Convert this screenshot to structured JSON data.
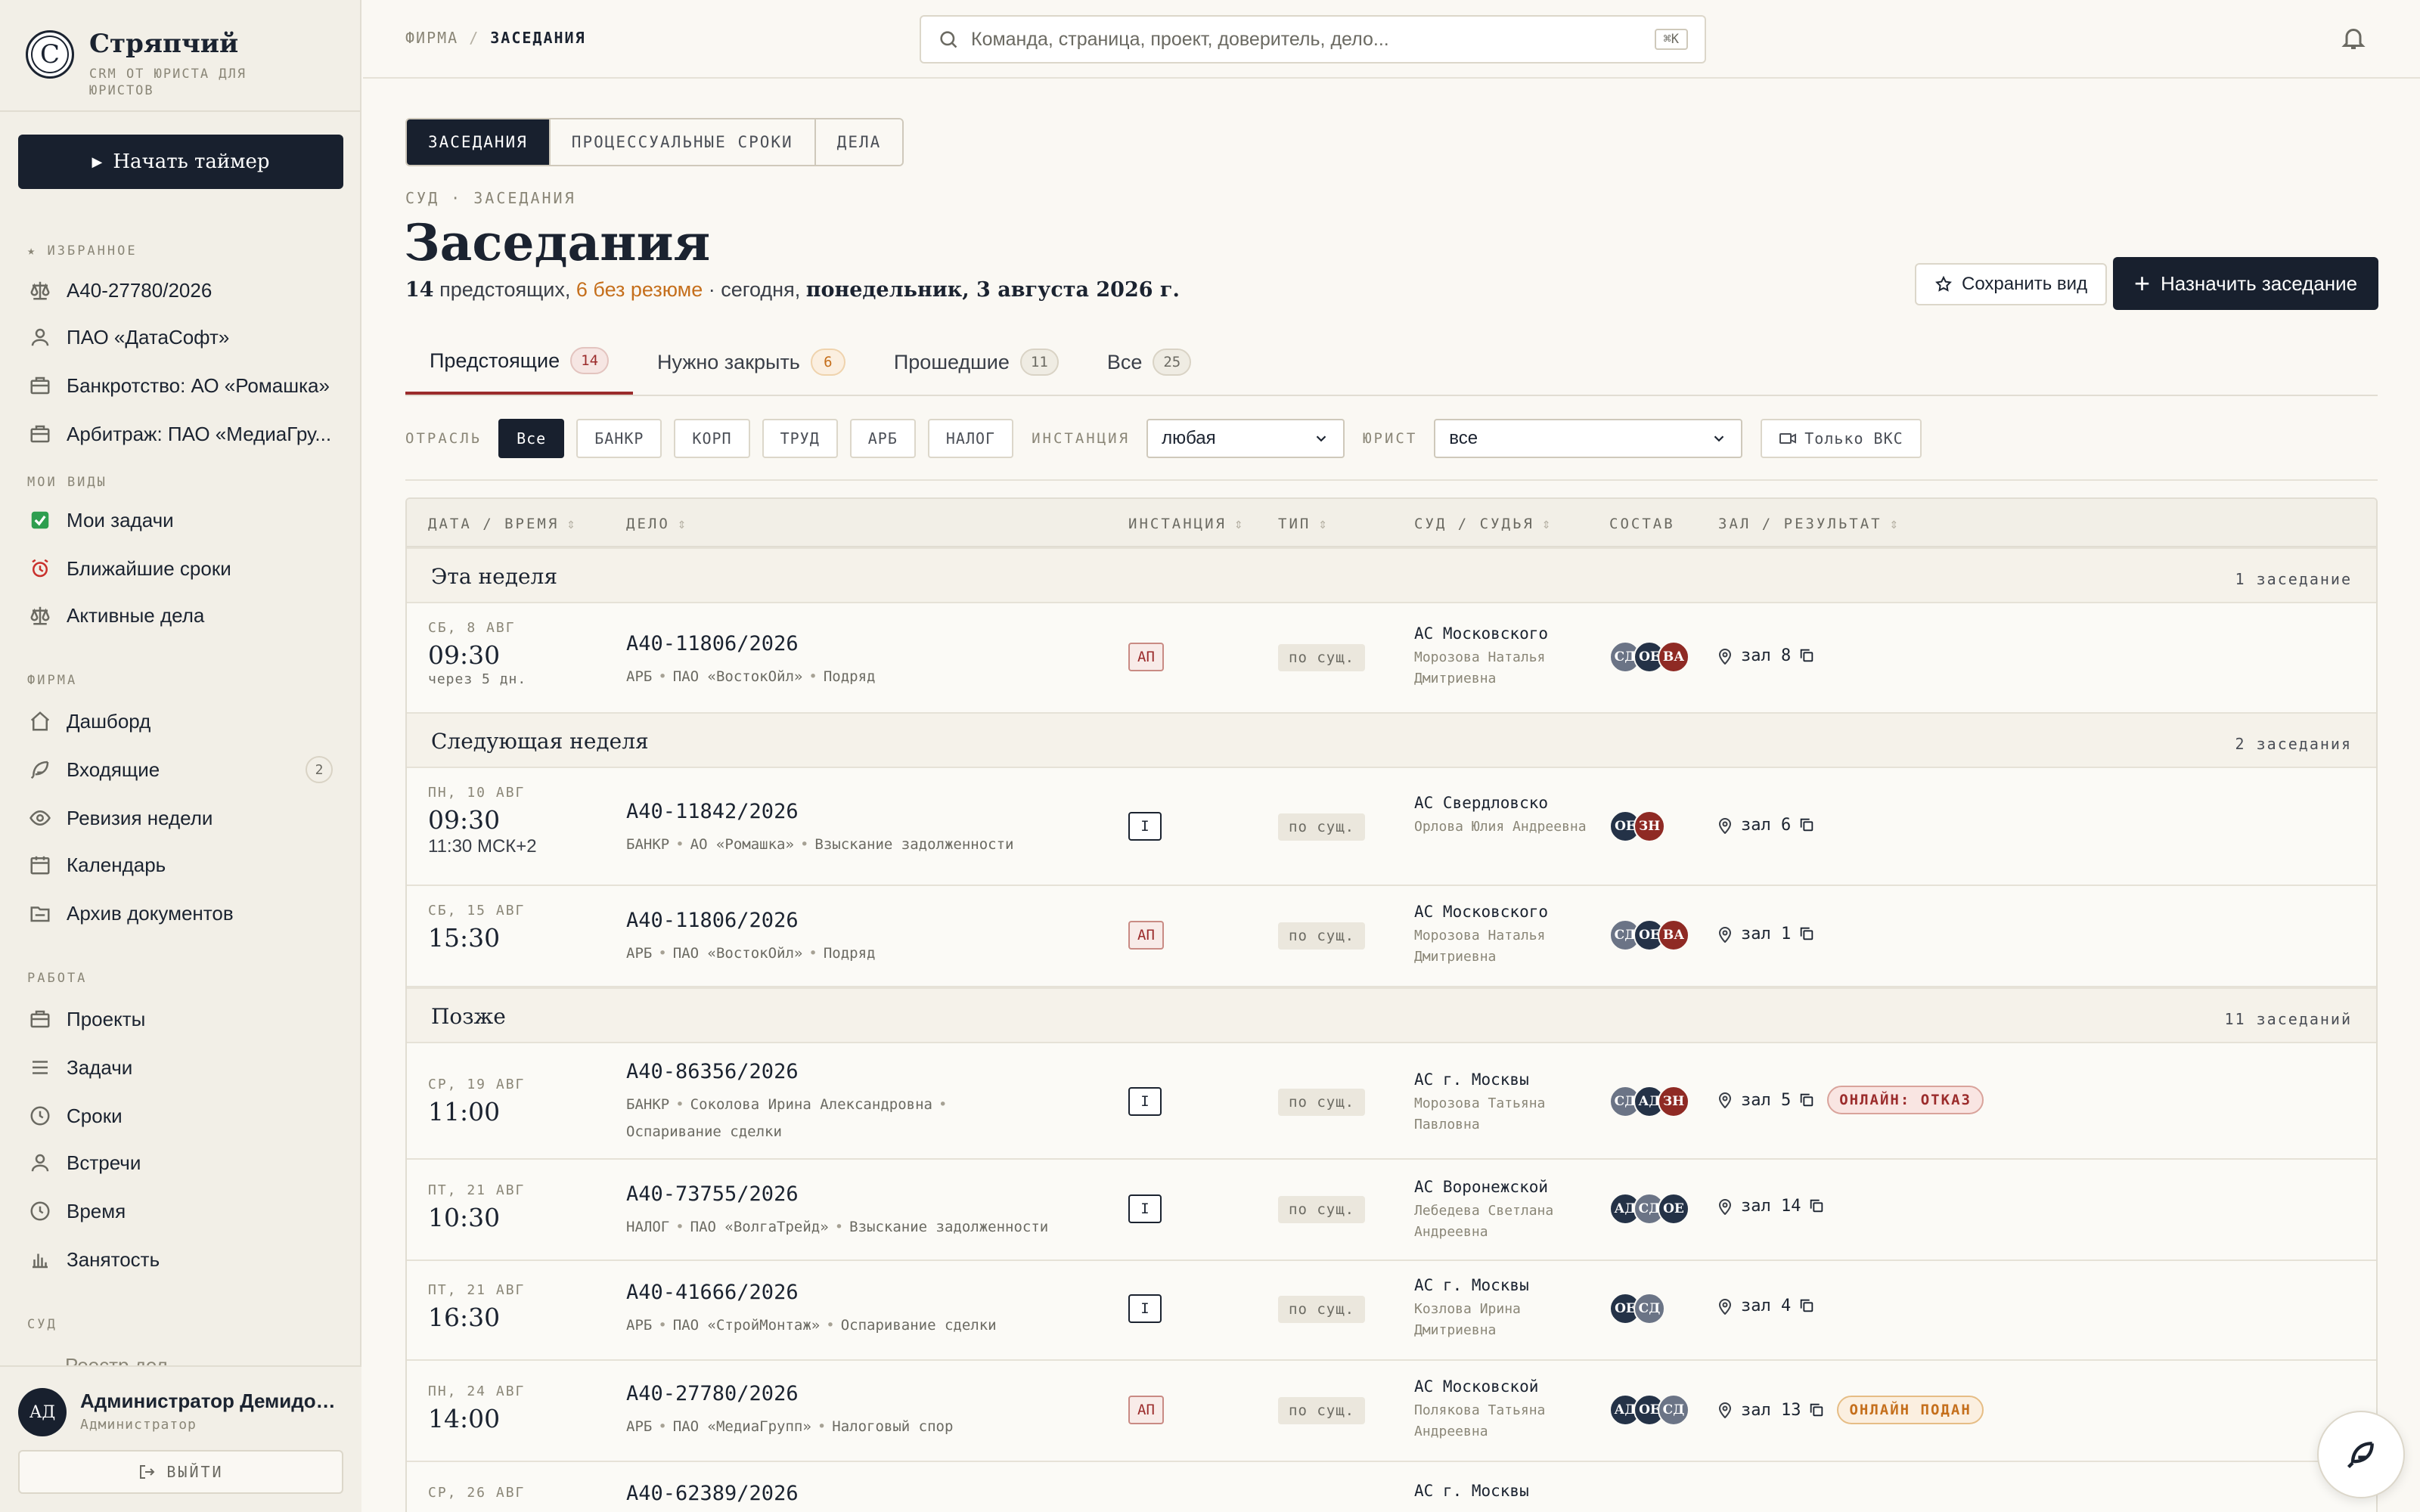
{
  "brand": {
    "logo_letter": "С",
    "name": "Стряпчий",
    "subtitle": "CRM ОТ ЮРИСТА ДЛЯ ЮРИСТОВ"
  },
  "sidebar": {
    "timer_label": "Начать таймер",
    "favorites_label": "ИЗБРАННОЕ",
    "favorites": [
      {
        "label": "А40-27780/2026",
        "icon": "scales-icon"
      },
      {
        "label": "ПАО «ДатаСофт»",
        "icon": "person-icon"
      },
      {
        "label": "Банкротство: АО «Ромашка»",
        "icon": "briefcase-icon"
      },
      {
        "label": "Арбитраж: ПАО «МедиаГру...",
        "icon": "briefcase-icon"
      }
    ],
    "views_label": "МОИ ВИДЫ",
    "views": [
      {
        "label": "Мои задачи",
        "icon": "check-icon"
      },
      {
        "label": "Ближайшие сроки",
        "icon": "alarm-clock-icon"
      },
      {
        "label": "Активные дела",
        "icon": "scales-icon"
      }
    ],
    "firm_label": "ФИРМА",
    "firm": [
      {
        "label": "Дашборд",
        "icon": "home-icon"
      },
      {
        "label": "Входящие",
        "icon": "feather-icon",
        "badge": "2"
      },
      {
        "label": "Ревизия недели",
        "icon": "eye-icon"
      },
      {
        "label": "Календарь",
        "icon": "calendar-icon"
      },
      {
        "label": "Архив документов",
        "icon": "folder-icon"
      }
    ],
    "work_label": "РАБОТА",
    "work": [
      {
        "label": "Проекты",
        "icon": "briefcase-icon"
      },
      {
        "label": "Задачи",
        "icon": "list-icon"
      },
      {
        "label": "Сроки",
        "icon": "clock-icon"
      },
      {
        "label": "Встречи",
        "icon": "person-icon"
      },
      {
        "label": "Время",
        "icon": "clock-icon"
      },
      {
        "label": "Занятость",
        "icon": "bar-chart-icon"
      }
    ],
    "court_label": "СУД",
    "court_cut_item": "Реестр дел",
    "user": {
      "initials": "АД",
      "name": "Администратор Демидов А...",
      "role": "Администратор"
    },
    "logout_label": "ВЫЙТИ"
  },
  "topbar": {
    "crumb_root": "ФИРМА",
    "crumb_sep": "/",
    "crumb_current": "ЗАСЕДАНИЯ",
    "search_placeholder": "Команда, страница, проект, доверитель, дело...",
    "search_shortcut": "⌘K"
  },
  "main": {
    "segments": [
      "ЗАСЕДАНИЯ",
      "ПРОЦЕССУАЛЬНЫЕ СРОКИ",
      "ДЕЛА"
    ],
    "kicker": "СУД · ЗАСЕДАНИЯ",
    "title": "Заседания",
    "summary": {
      "count": "14",
      "count_suffix": " предстоящих, ",
      "warn": "6 без резюме",
      "mid": " · сегодня, ",
      "date": "понедельник, 3 августа 2026 г."
    },
    "save_view_label": "Сохранить вид",
    "schedule_label": "Назначить заседание",
    "tabs": [
      {
        "label": "Предстоящие",
        "count": "14"
      },
      {
        "label": "Нужно закрыть",
        "count": "6"
      },
      {
        "label": "Прошедшие",
        "count": "11"
      },
      {
        "label": "Все",
        "count": "25"
      }
    ],
    "filters": {
      "branch_label": "ОТРАСЛЬ",
      "branches": [
        "Все",
        "БАНКР",
        "КОРП",
        "ТРУД",
        "АРБ",
        "НАЛОГ"
      ],
      "instance_label": "ИНСТАНЦИЯ",
      "instance_value": "любая",
      "lawyer_label": "ЮРИСТ",
      "lawyer_value": "все",
      "vks_label": "Только ВКС"
    },
    "columns": [
      "ДАТА / ВРЕМЯ",
      "ДЕЛО",
      "ИНСТАНЦИЯ",
      "ТИП",
      "СУД / СУДЬЯ",
      "СОСТАВ",
      "ЗАЛ / РЕЗУЛЬТАТ"
    ],
    "groups": [
      {
        "title": "Эта неделя",
        "count": "1 заседание"
      },
      {
        "title": "Следующая неделя",
        "count": "2 заседания"
      },
      {
        "title": "Позже",
        "count": "11 заседаний"
      }
    ],
    "rows": [
      {
        "day": "СБ, 8 АВГ",
        "time": "09:30",
        "sub": "через 5 дн.",
        "case": "А40-11806/2026",
        "branch": "АРБ",
        "party": "ПАО «ВостокОйл»",
        "matter": "Подряд",
        "instance": "АП",
        "type": "по сущ.",
        "court": "АС Московского",
        "judge": "Морозова Наталья Дмитриевна",
        "team": [
          "СД",
          "ОЕ",
          "ВА"
        ],
        "room": "зал 8"
      },
      {
        "day": "ПН, 10 АВГ",
        "time": "09:30",
        "sub": "11:30 МСК+2",
        "case": "А40-11842/2026",
        "branch": "БАНКР",
        "party": "АО «Ромашка»",
        "matter": "Взыскание задолженности",
        "instance": "I",
        "type": "по сущ.",
        "court": "АС Свердловско",
        "judge": "Орлова Юлия Андреевна",
        "team": [
          "ОЕ",
          "ЗН"
        ],
        "room": "зал 6"
      },
      {
        "day": "СБ, 15 АВГ",
        "time": "15:30",
        "sub": "",
        "case": "А40-11806/2026",
        "branch": "АРБ",
        "party": "ПАО «ВостокОйл»",
        "matter": "Подряд",
        "instance": "АП",
        "type": "по сущ.",
        "court": "АС Московского",
        "judge": "Морозова Наталья Дмитриевна",
        "team": [
          "СД",
          "ОЕ",
          "ВА"
        ],
        "room": "зал 1"
      },
      {
        "day": "СР, 19 АВГ",
        "time": "11:00",
        "sub": "",
        "case": "А40-86356/2026",
        "branch": "БАНКР",
        "party": "Соколова Ирина Александровна",
        "matter": "Оспаривание сделки",
        "instance": "I",
        "type": "по сущ.",
        "court": "АС г. Москвы",
        "judge": "Морозова Татьяна Павловна",
        "team": [
          "СД",
          "АД",
          "ЗН"
        ],
        "room": "зал 5",
        "status": "ОНЛАЙН: ОТКАЗ"
      },
      {
        "day": "ПТ, 21 АВГ",
        "time": "10:30",
        "sub": "",
        "case": "А40-73755/2026",
        "branch": "НАЛОГ",
        "party": "ПАО «ВолгаТрейд»",
        "matter": "Взыскание задолженности",
        "instance": "I",
        "type": "по сущ.",
        "court": "АС Воронежской",
        "judge": "Лебедева Светлана Андреевна",
        "team": [
          "АД",
          "СД",
          "ОЕ"
        ],
        "room": "зал 14"
      },
      {
        "day": "ПТ, 21 АВГ",
        "time": "16:30",
        "sub": "",
        "case": "А40-41666/2026",
        "branch": "АРБ",
        "party": "ПАО «СтройМонтаж»",
        "matter": "Оспаривание сделки",
        "instance": "I",
        "type": "по сущ.",
        "court": "АС г. Москвы",
        "judge": "Козлова Ирина Дмитриевна",
        "team": [
          "ОЕ",
          "СД"
        ],
        "room": "зал 4"
      },
      {
        "day": "ПН, 24 АВГ",
        "time": "14:00",
        "sub": "",
        "case": "А40-27780/2026",
        "branch": "АРБ",
        "party": "ПАО «МедиаГрупп»",
        "matter": "Налоговый спор",
        "instance": "АП",
        "type": "по сущ.",
        "court": "АС Московской",
        "judge": "Полякова Татьяна Андреевна",
        "team": [
          "АД",
          "ОЕ",
          "СД"
        ],
        "room": "зал 13",
        "status": "ОНЛАЙН ПОДАН"
      },
      {
        "day": "СР, 26 АВГ",
        "time": "",
        "sub": "",
        "case": "А40-62389/2026",
        "branch": "",
        "party": "",
        "matter": "",
        "instance": "",
        "type": "",
        "court": "АС г. Москвы",
        "judge": "",
        "team": [],
        "room": ""
      }
    ]
  },
  "colors": {
    "accent": "#18202e",
    "warn": "#c56f1c",
    "danger": "#9b2c2c",
    "bg": "#faf8f3"
  }
}
